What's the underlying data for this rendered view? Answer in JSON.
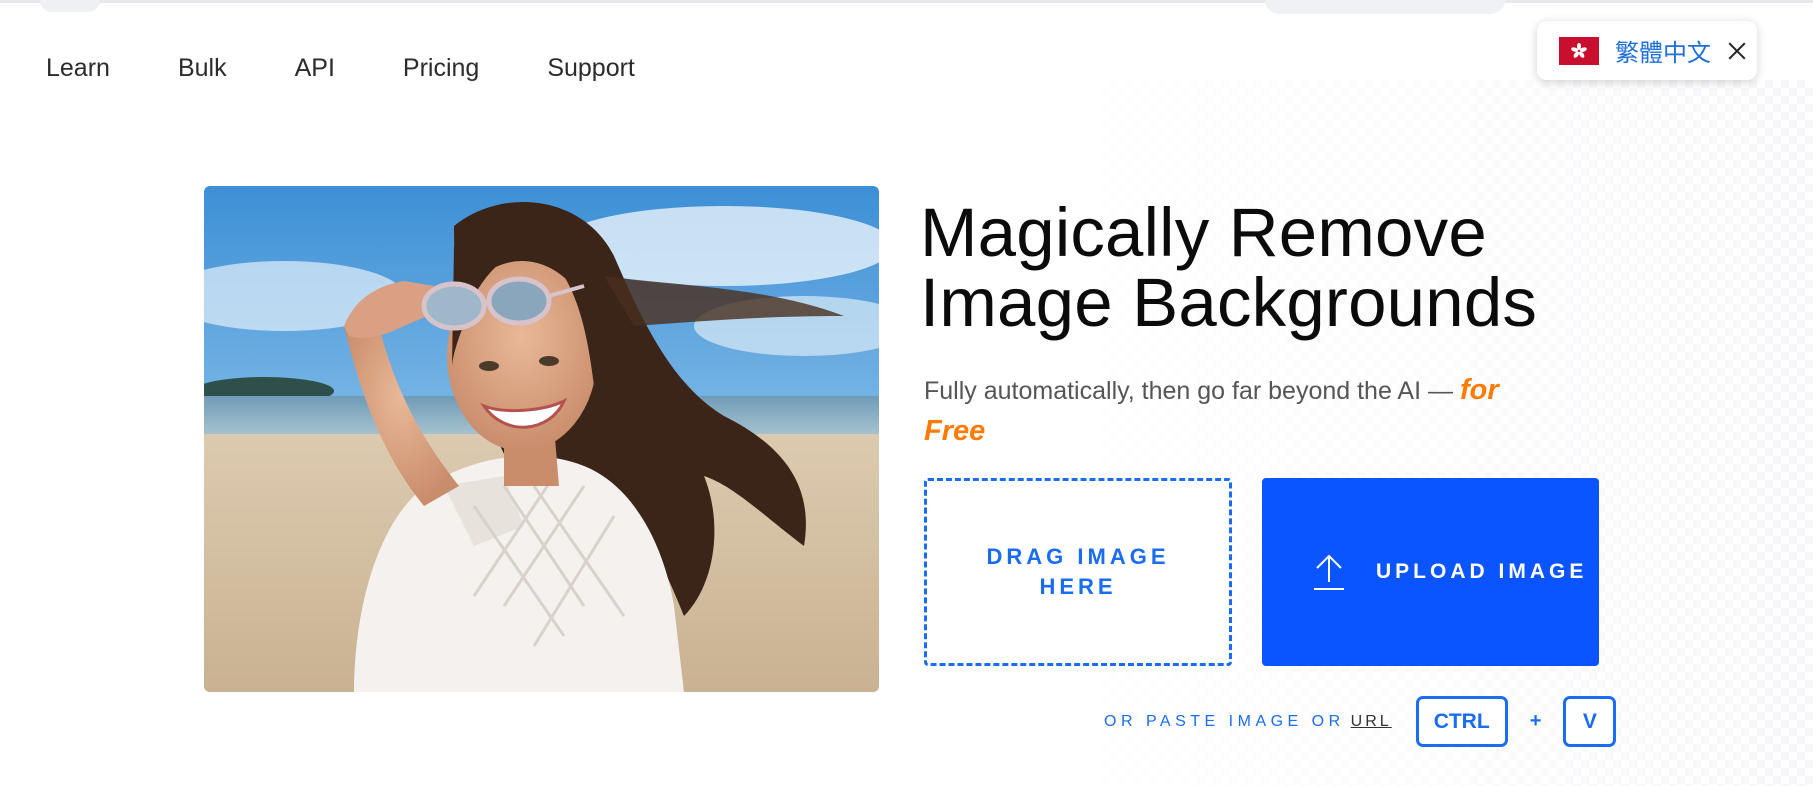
{
  "nav": {
    "items": [
      {
        "label": "Learn"
      },
      {
        "label": "Bulk"
      },
      {
        "label": "API"
      },
      {
        "label": "Pricing"
      },
      {
        "label": "Support"
      }
    ]
  },
  "language_popup": {
    "flag_icon": "hong-kong-flag-icon",
    "label": "繁體中文",
    "close_icon": "close-icon"
  },
  "hero": {
    "image_subject": "smiling woman on beach lifting sunglasses",
    "title_line1": "Magically Remove",
    "title_line2": "Image Backgrounds",
    "subtitle": "Fully automatically, then go far beyond the AI —",
    "subtitle_highlight": "for Free",
    "drop_zone_label": "DRAG IMAGE HERE",
    "upload_button_label": "UPLOAD IMAGE",
    "upload_icon": "upload-arrow-icon",
    "paste_text": "OR PASTE IMAGE OR",
    "paste_url": "URL",
    "key_ctrl": "CTRL",
    "key_plus": "+",
    "key_v": "V"
  },
  "colors": {
    "accent_blue": "#0a55ff",
    "link_blue": "#1a6cf0",
    "highlight_orange": "#ff7b00"
  }
}
